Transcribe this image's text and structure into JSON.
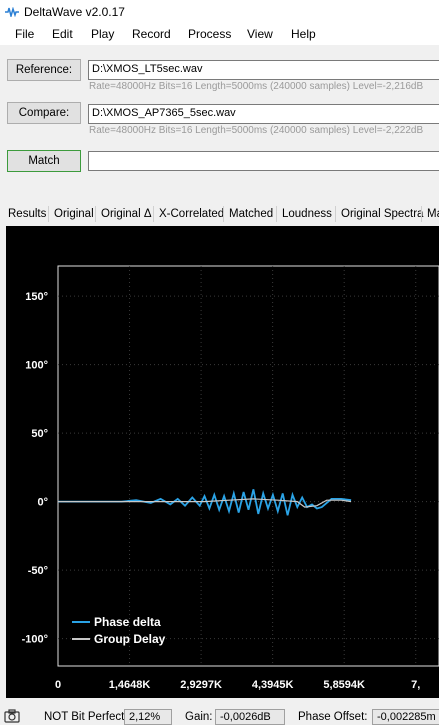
{
  "window": {
    "title": "DeltaWave v2.0.17"
  },
  "menu": [
    "File",
    "Edit",
    "Play",
    "Record",
    "Process",
    "View",
    "Help"
  ],
  "reference": {
    "button": "Reference:",
    "path": "D:\\XMOS_LT5sec.wav",
    "meta": "Rate=48000Hz Bits=16 Length=5000ms (240000 samples) Level=-2,216dB"
  },
  "compare": {
    "button": "Compare:",
    "path": "D:\\XMOS_AP7365_5sec.wav",
    "meta": "Rate=48000Hz Bits=16 Length=5000ms (240000 samples) Level=-2,222dB"
  },
  "match": {
    "button": "Match",
    "value": ""
  },
  "tabs": [
    "Results",
    "Original",
    "Original Δ",
    "X-Correlated",
    "Matched",
    "Loudness",
    "Original Spectra",
    "Ma"
  ],
  "chart_data": {
    "type": "line",
    "x_ticks": [
      "0",
      "1,4648K",
      "2,9297K",
      "4,3945K",
      "5,8594K",
      "7,"
    ],
    "y_ticks": [
      "150°",
      "100°",
      "50°",
      "0°",
      "-50°",
      "-100°"
    ],
    "y_tick_values": [
      150,
      100,
      50,
      0,
      -50,
      -100
    ],
    "ylim": [
      -120,
      172
    ],
    "xlim": [
      0,
      7.8
    ],
    "series": [
      {
        "name": "Phase delta",
        "color": "#2aa3e6",
        "x": [
          0,
          0.5,
          1.0,
          1.3,
          1.6,
          1.9,
          2.1,
          2.3,
          2.45,
          2.6,
          2.75,
          2.9,
          3.0,
          3.1,
          3.2,
          3.3,
          3.4,
          3.5,
          3.6,
          3.7,
          3.8,
          3.9,
          4.0,
          4.1,
          4.2,
          4.3,
          4.4,
          4.5,
          4.6,
          4.7,
          4.8,
          4.9,
          5.0,
          5.1,
          5.2,
          5.3,
          5.4,
          5.6,
          5.8,
          6.0
        ],
        "y": [
          0,
          0,
          0,
          0,
          1,
          -1,
          2,
          -2,
          2,
          -3,
          3,
          -3,
          4,
          -5,
          5,
          -6,
          4,
          -7,
          6,
          -8,
          7,
          -6,
          9,
          -9,
          6,
          -5,
          5,
          -7,
          6,
          -10,
          5,
          -4,
          3,
          -4,
          -2,
          -5,
          -4,
          2,
          2,
          1
        ]
      },
      {
        "name": "Group Delay",
        "color": "#c8c8c8",
        "x": [
          0,
          1.0,
          2.0,
          3.0,
          3.5,
          4.0,
          4.5,
          4.9,
          5.05,
          5.3,
          5.5,
          5.8,
          6.0
        ],
        "y": [
          0,
          0,
          0,
          0,
          1,
          2,
          1,
          0,
          -4,
          -3,
          1,
          1,
          0
        ]
      }
    ]
  },
  "status": {
    "bit_perfect": "NOT Bit Perfect",
    "bit_perfect_value": "2,12%",
    "gain_label": "Gain:",
    "gain_value": "-0,0026dB",
    "phase_offset_label": "Phase Offset:",
    "phase_offset_value": "-0,002285m"
  }
}
